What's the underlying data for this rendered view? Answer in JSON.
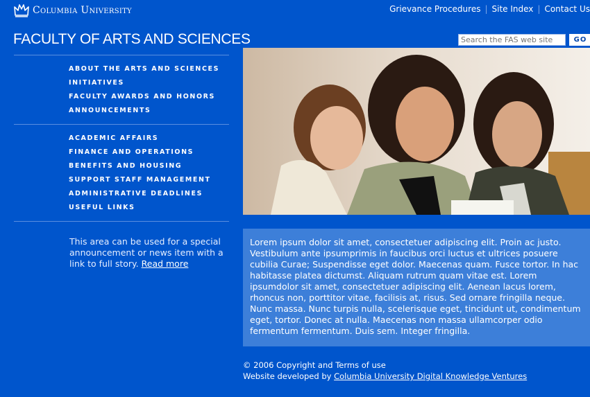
{
  "header": {
    "logo_text": "Columbia University",
    "top_links": [
      "Grievance Procedures",
      "Site Index",
      "Contact Us"
    ],
    "site_title": "FACULTY OF ARTS AND SCIENCES",
    "search_placeholder": "Search the FAS web site",
    "search_button": "GO"
  },
  "nav_primary": [
    "ABOUT THE ARTS AND SCIENCES",
    "INITIATIVES",
    "FACULTY AWARDS AND HONORS",
    "ANNOUNCEMENTS"
  ],
  "nav_secondary": [
    "ACADEMIC AFFAIRS",
    "FINANCE AND OPERATIONS",
    "BENEFITS AND HOUSING",
    "SUPPORT STAFF MANAGEMENT",
    "ADMINISTRATIVE DEADLINES",
    "USEFUL LINKS"
  ],
  "promo": {
    "text": "This area can be used for a special announcement or news item with a link to full story.",
    "link": "Read more"
  },
  "main": {
    "body": "Lorem ipsum dolor sit amet, consectetuer adipiscing elit. Proin ac justo. Vestibulum ante ipsumprimis in faucibus orci luctus et ultrices posuere cubilia Curae; Suspendisse eget dolor. Maecenas quam. Fusce tortor. In hac habitasse platea dictumst. Aliquam rutrum quam vitae est. Lorem ipsumdolor sit amet, consectetuer adipiscing elit. Aenean lacus lorem, rhoncus non, porttitor vitae, facilisis at, risus. Sed ornare fringilla neque. Nunc massa. Nunc turpis nulla, scelerisque eget, tincidunt ut, condimentum eget, tortor. Donec at nulla. Maecenas non massa ullamcorper odio fermentum fermentum. Duis sem. Integer fringilla."
  },
  "footer": {
    "copyright": "© 2006 Copyright and Terms of use",
    "developed_prefix": "Website developed by ",
    "developed_link": "Columbia University Digital Knowledge Ventures"
  },
  "colors": {
    "page_bg": "#0055cc",
    "text_panel_bg": "#3d7fd9",
    "rule": "#5a8fe0"
  }
}
